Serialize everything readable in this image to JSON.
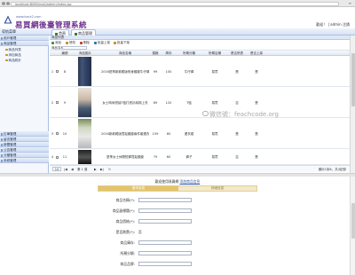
{
  "browser": {
    "url": "localhost:8080/mall/admin/index.jsp",
    "menu_icon": "menu-icon"
  },
  "header": {
    "site_url": "www.back2.com",
    "title": "易買網後臺管理系統",
    "welcome": "歡迎！ | admin 注銷"
  },
  "sidebar": {
    "heading": "導航菜單",
    "groups": [
      {
        "label": "用戶管理"
      },
      {
        "label": "商品管理"
      },
      {
        "label": "訂單管理"
      },
      {
        "label": "留言管理"
      },
      {
        "label": "新聞管理"
      },
      {
        "label": "公告管理"
      },
      {
        "label": "分類管理"
      },
      {
        "label": "系統管理"
      }
    ],
    "items": [
      {
        "label": "商品列表"
      },
      {
        "label": "添加商品"
      },
      {
        "label": "商品統計"
      }
    ]
  },
  "tabs": [
    {
      "label": "首頁"
    },
    {
      "label": "商品管理"
    }
  ],
  "toolbar": {
    "panel_title": "商品列表",
    "buttons": [
      {
        "label": "添加",
        "color": "#3d8b3d"
      },
      {
        "label": "修改",
        "color": "#c98a1f"
      },
      {
        "label": "刪除",
        "color": "#c0392b"
      },
      {
        "label": "批量上架",
        "color": "#2f6db5"
      },
      {
        "label": "批量下架",
        "color": "#c98a1f"
      }
    ],
    "search_label": "商品名稱"
  },
  "grid": {
    "columns": [
      "",
      "",
      "編號",
      "商品圖片",
      "商品名稱",
      "價格",
      "庫存",
      "所屬分類",
      "所屬店鋪",
      "是否熱賣",
      "是否上架"
    ],
    "rows": [
      {
        "idx": "1",
        "id": "8",
        "name": "2016夏季新款韓版修身顯瘦牛仔褲女",
        "price": "99",
        "stock": "100",
        "cat": "牛仔褲",
        "shop": "易買",
        "hot": "是",
        "on": "是"
      },
      {
        "idx": "2",
        "id": "9",
        "name": "女士時尚短袖T恤打底衫純棉上衣",
        "price": "69",
        "stock": "120",
        "cat": "T恤",
        "shop": "易買",
        "hot": "否",
        "on": "是"
      },
      {
        "idx": "3",
        "id": "10",
        "name": "2016新款韓版寬鬆顯瘦兩件套連衣裙",
        "price": "159",
        "stock": "80",
        "cat": "連衣裙",
        "shop": "易買",
        "hot": "是",
        "on": "是"
      },
      {
        "idx": "4",
        "id": "11",
        "name": "夏季女士休閒短褲寬鬆顯瘦",
        "price": "79",
        "stock": "60",
        "cat": "褲子",
        "shop": "易買",
        "hot": "否",
        "on": "是"
      }
    ],
    "thumb_styles": [
      "jeans",
      "tee",
      "mix",
      "dark"
    ]
  },
  "pager": {
    "page_size": "10",
    "page_label": "第 1 頁",
    "total": "顯示1到4，共4記錄"
  },
  "watermark": "微信號：feachcode.org",
  "form": {
    "title_prefix": "歡迎使用易買網",
    "title_link": "添加商品信息",
    "steps": [
      "基本信息",
      "詳細信息"
    ],
    "fields": [
      {
        "label": "商品名稱(*):",
        "kind": "input"
      },
      {
        "label": "商品副標題(*):",
        "kind": "input"
      },
      {
        "label": "商品價格(*):",
        "kind": "input"
      },
      {
        "label": "是否熱賣(*):",
        "kind": "static",
        "value": "否"
      },
      {
        "label": "商品庫存:",
        "kind": "input"
      },
      {
        "label": "所屬分類:",
        "kind": "input"
      },
      {
        "label": "商品品牌:",
        "kind": "input"
      },
      {
        "label": "商品狀態:",
        "kind": "input"
      }
    ]
  }
}
